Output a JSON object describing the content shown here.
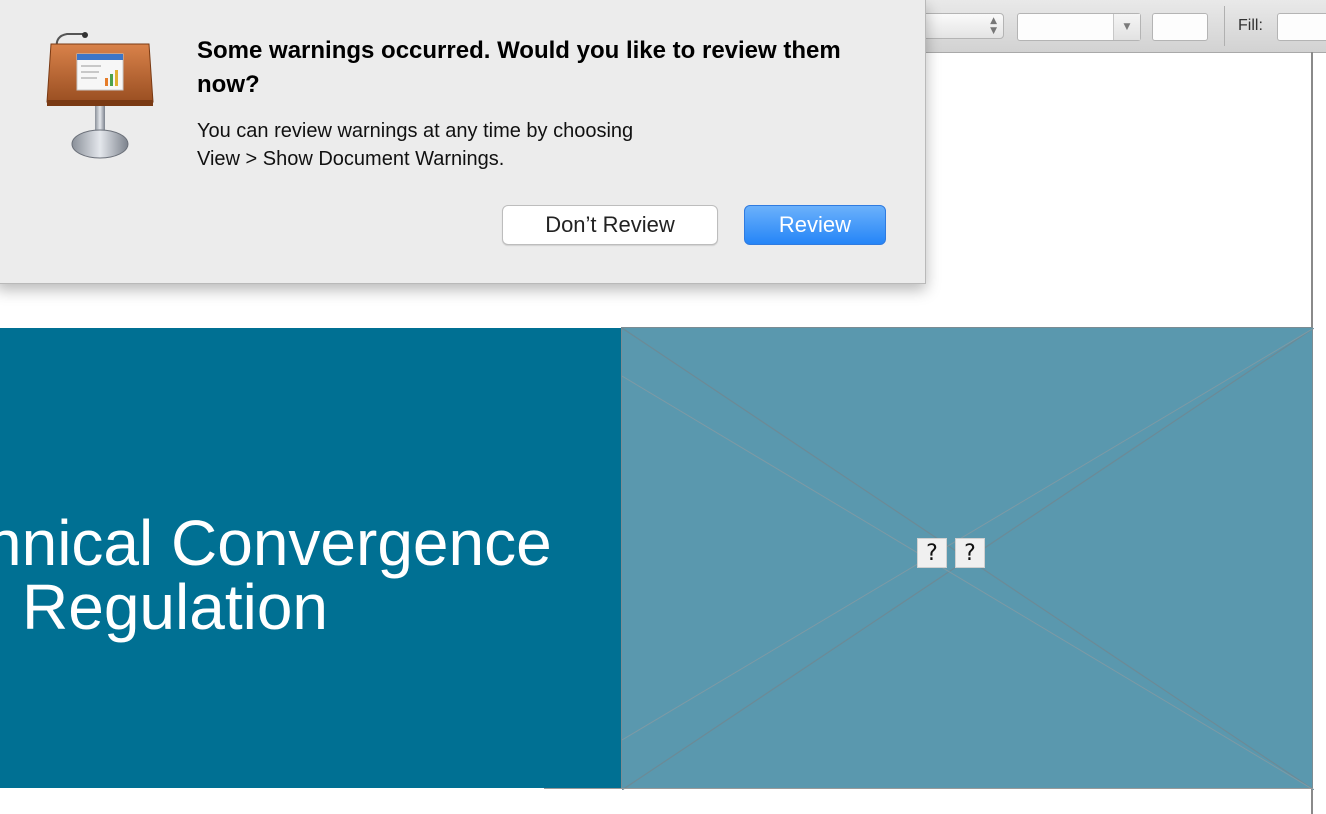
{
  "toolbar": {
    "fill_label": "Fill:"
  },
  "slide": {
    "title_line1": "hnical Convergence",
    "title_line2": "Regulation",
    "placeholder_marks": [
      "?",
      "?"
    ]
  },
  "alert": {
    "app_icon": "keynote-app-icon",
    "title": "Some warnings occurred. Would you like to review them now?",
    "body_line1": "You can review warnings at any time by choosing",
    "body_line2": "View > Show Document Warnings.",
    "secondary_button": "Don’t Review",
    "primary_button": "Review"
  },
  "colors": {
    "slide_band": "#007093",
    "placeholder_fill": "#5a98ae",
    "primary_button": "#2585f7"
  }
}
